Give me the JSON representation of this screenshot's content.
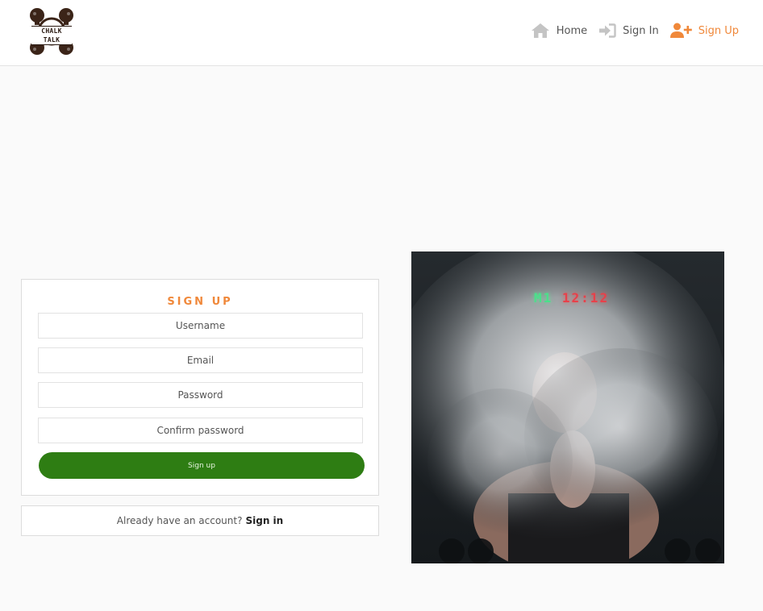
{
  "header": {
    "logo_text": "CHALK TALK",
    "nav": [
      {
        "label": "Home",
        "icon": "home-icon"
      },
      {
        "label": "Sign In",
        "icon": "sign-in-icon"
      },
      {
        "label": "Sign Up",
        "icon": "user-plus-icon"
      }
    ]
  },
  "signup": {
    "title": "SIGN UP",
    "username_placeholder": "Username",
    "email_placeholder": "Email",
    "password_placeholder": "Password",
    "confirm_placeholder": "Confirm password",
    "button_label": "Sign up"
  },
  "signin_prompt": {
    "text": "Already have an account?",
    "link": "Sign in"
  },
  "photo": {
    "timer_min": "M1",
    "timer_sec": "12:12"
  },
  "colors": {
    "accent": "#f0883a",
    "button": "#2e7d13",
    "background": "#fafafa"
  }
}
